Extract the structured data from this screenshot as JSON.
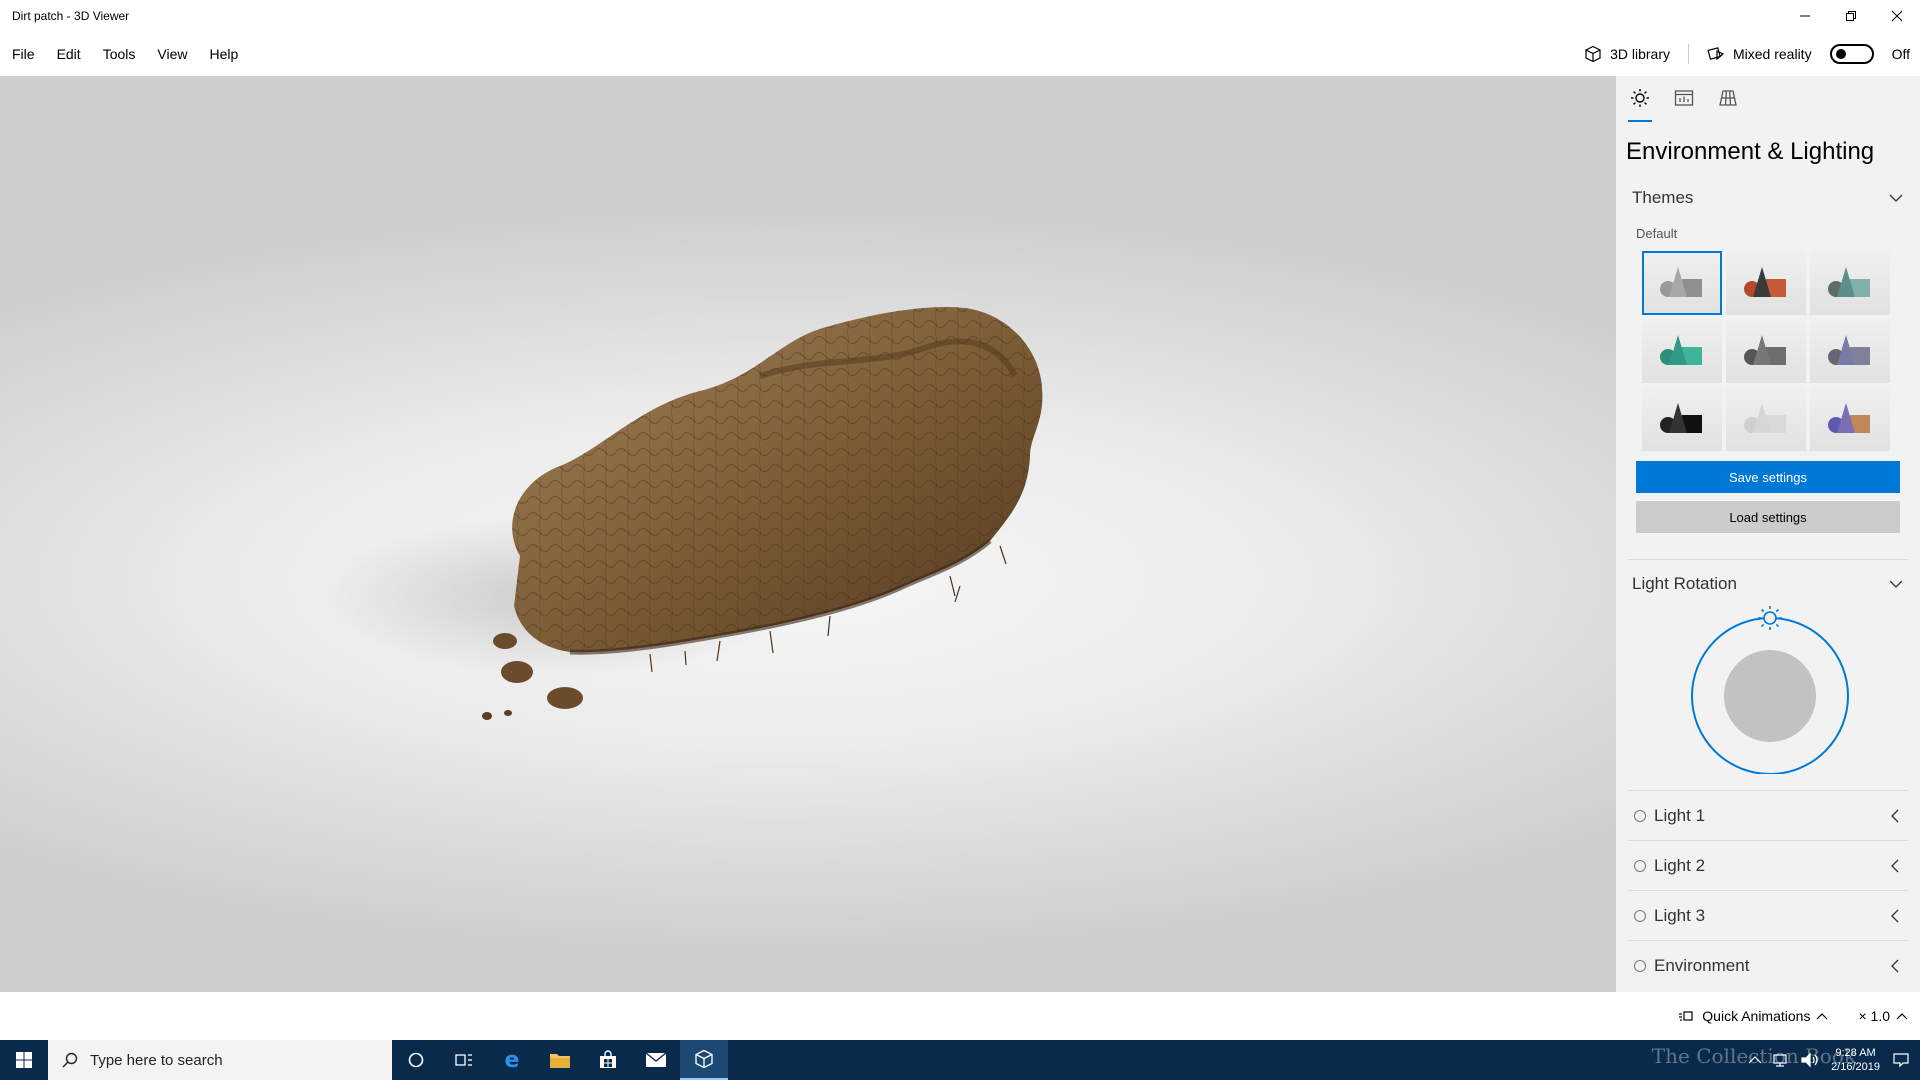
{
  "window": {
    "title": "Dirt patch - 3D Viewer"
  },
  "menu": {
    "items": [
      "File",
      "Edit",
      "Tools",
      "View",
      "Help"
    ]
  },
  "header": {
    "library_label": "3D library",
    "mixed_reality_label": "Mixed reality",
    "mixed_reality_state": "Off"
  },
  "viewport": {
    "model_name": "Dirt patch",
    "model_colors": {
      "base": "#7a5a33",
      "highlight": "#a2845a",
      "shadow": "#4f3720"
    }
  },
  "panel": {
    "tabs": [
      "sun-icon",
      "stats-icon",
      "grid-icon"
    ],
    "title": "Environment & Lighting",
    "themes": {
      "header": "Themes",
      "default_label": "Default",
      "tiles": [
        {
          "cone": "#a8a8a8",
          "ball": "#9a9a9a",
          "box": "#8f8f8f"
        },
        {
          "cone": "#3a3a3a",
          "ball": "#b5482a",
          "box": "#c45a36"
        },
        {
          "cone": "#5d8e8b",
          "ball": "#5f6a6a",
          "box": "#7fb0ac"
        },
        {
          "cone": "#2f9a86",
          "ball": "#2c8f7c",
          "box": "#40b39c"
        },
        {
          "cone": "#777777",
          "ball": "#555555",
          "box": "#6e6e6e"
        },
        {
          "cone": "#7a7aa6",
          "ball": "#666677",
          "box": "#80809a"
        },
        {
          "cone": "#333333",
          "ball": "#222222",
          "box": "#111111"
        },
        {
          "cone": "#d6d6d6",
          "ball": "#cfcfcf",
          "box": "#d9d9d9"
        },
        {
          "cone": "#7a6fb0",
          "ball": "#5d5bb0",
          "box": "#c0875a"
        }
      ]
    },
    "save_settings": "Save settings",
    "load_settings": "Load settings",
    "light_rotation": {
      "header": "Light Rotation"
    },
    "lights": [
      {
        "label": "Light 1"
      },
      {
        "label": "Light 2"
      },
      {
        "label": "Light 3"
      },
      {
        "label": "Environment"
      }
    ]
  },
  "statusbar": {
    "quick_animations": "Quick Animations",
    "speed": "× 1.0"
  },
  "taskbar": {
    "search_placeholder": "Type here to search",
    "time": "9:28 AM",
    "date": "2/16/2019",
    "watermark": "The Collection Book"
  },
  "colors": {
    "accent": "#0078d7",
    "taskbar": "#0a2a4b",
    "panel": "#f2f2f2"
  }
}
